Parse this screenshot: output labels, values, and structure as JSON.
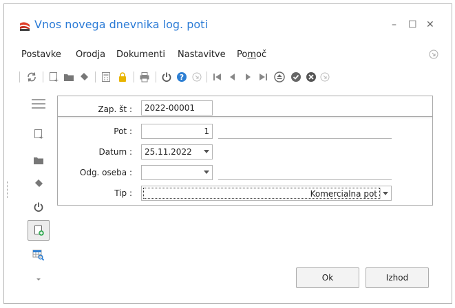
{
  "window": {
    "title": "Vnos novega dnevnika log. poti",
    "minimize": "–",
    "maximize": "☐",
    "close": "✕"
  },
  "menu": {
    "items": [
      "Postavke",
      "Orodja",
      "Dokumenti",
      "Nastavitve"
    ],
    "help_prefix": "Po",
    "help_underlined": "m",
    "help_suffix": "oč"
  },
  "toolbar": {
    "icons": [
      "refresh-icon",
      "new-doc-icon",
      "folder-icon",
      "eraser-icon",
      "calculator-icon",
      "lock-icon",
      "print-icon",
      "power-icon",
      "help-icon",
      "arrow-icon",
      "first-icon",
      "prev-icon",
      "next-icon",
      "last-icon",
      "eject-icon",
      "confirm-icon",
      "cancel-icon",
      "arrow2-icon"
    ]
  },
  "form": {
    "zap_label": "Zap. št :",
    "zap_value": "2022-00001",
    "pot_label": "Pot :",
    "pot_value": "1",
    "datum_label": "Datum :",
    "datum_value": "25.11.2022",
    "odg_label": "Odg. oseba :",
    "odg_value": "",
    "tip_label": "Tip :",
    "tip_value": "Komercialna pot"
  },
  "buttons": {
    "ok": "Ok",
    "exit": "Izhod"
  },
  "colors": {
    "title": "#2b7bd6",
    "accent_green": "#2fa84f",
    "help_blue": "#2d7fd3",
    "lock_yellow": "#e8b400"
  }
}
